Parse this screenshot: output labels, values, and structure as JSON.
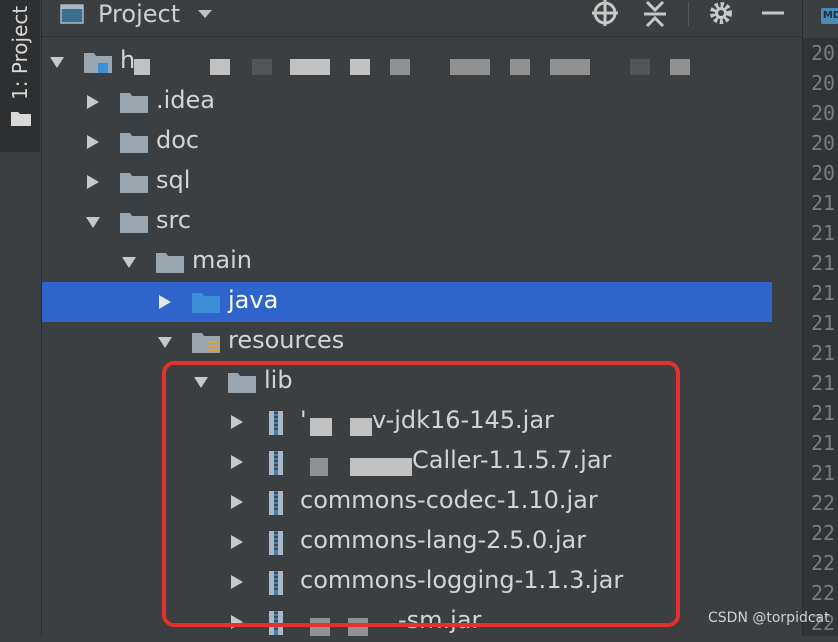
{
  "sidebar": {
    "tab_label": "1: Project"
  },
  "header": {
    "title": "Project"
  },
  "gutter": {
    "line_numbers": [
      "20",
      "20",
      "20",
      "20",
      "20",
      "21",
      "21",
      "21",
      "21",
      "21",
      "21",
      "21",
      "21",
      "21",
      "21",
      "22",
      "22",
      "22",
      "22",
      "22",
      "22"
    ]
  },
  "tree": {
    "root_label": "h",
    "items": [
      {
        "label": ".idea"
      },
      {
        "label": "doc"
      },
      {
        "label": "sql"
      },
      {
        "label": "src"
      },
      {
        "label": "main"
      },
      {
        "label": "java"
      },
      {
        "label": "resources"
      },
      {
        "label": "lib"
      },
      {
        "label": "v-jdk16-145.jar"
      },
      {
        "label": "Caller-1.1.5.7.jar"
      },
      {
        "label": "commons-codec-1.10.jar"
      },
      {
        "label": "commons-lang-2.5.0.jar"
      },
      {
        "label": "commons-logging-1.1.3.jar"
      },
      {
        "label": "-sm.jar"
      }
    ]
  },
  "watermark": "CSDN @torpidcat",
  "colors": {
    "selection": "#2f65ca",
    "highlight_border": "#e4312b",
    "folder": "#9aa7b0",
    "java_folder": "#3d8fd8"
  }
}
